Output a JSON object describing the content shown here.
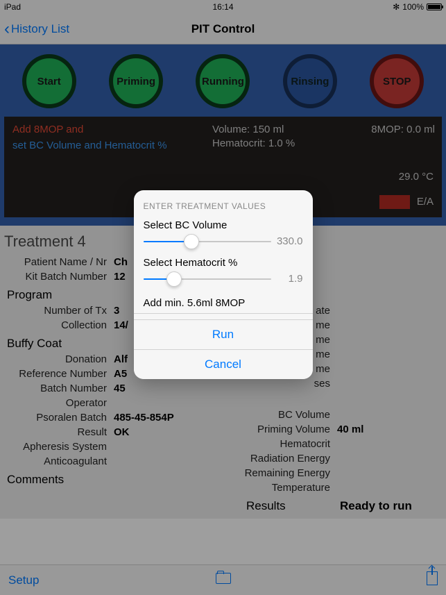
{
  "status_bar": {
    "device": "iPad",
    "time": "16:14",
    "bt": "✻",
    "battery": "100%"
  },
  "nav": {
    "back": "History List",
    "title": "PIT Control"
  },
  "buttons": {
    "start": "Start",
    "priming": "Priming",
    "running": "Running",
    "rinsing": "Rinsing",
    "stop": "STOP"
  },
  "info": {
    "line1": "Add 8MOP and",
    "line2": "set BC Volume and Hematocrit %",
    "vol": "Volume: 150 ml",
    "hct": "Hematocrit: 1.0 %",
    "mop": "8MOP: 0.0 ml",
    "temp": "29.0 °C",
    "ea": "E/A"
  },
  "treatment_title": "Treatment 4",
  "labels": {
    "patient": "Patient Name / Nr",
    "kit": "Kit Batch Number",
    "program": "Program",
    "ntx": "Number of Tx",
    "collection": "Collection",
    "buffy": "Buffy Coat",
    "donation": "Donation",
    "ref": "Reference Number",
    "batch": "Batch Number",
    "operator": "Operator",
    "psoralen": "Psoralen Batch",
    "result": "Result",
    "apheresis": "Apheresis System",
    "anticoag": "Anticoagulant",
    "comments": "Comments",
    "date": "ate",
    "starttime": "me",
    "runtime": "me",
    "primetime": "me",
    "rinsetime": "me",
    "pauses": "ses",
    "bcvol": "BC Volume",
    "primevol": "Priming Volume",
    "hematocrit": "Hematocrit",
    "radenergy": "Radiation Energy",
    "remenergy": "Remaining Energy",
    "temperature": "Temperature",
    "results": "Results"
  },
  "values": {
    "patient": "Ch",
    "kit": "12",
    "ntx": "3",
    "collection": "14/",
    "donation": "Alf",
    "ref": "A5",
    "batch": "45",
    "operator": "",
    "psoralen": "485-45-854P",
    "result": "OK",
    "apheresis": "",
    "anticoag": "",
    "primevol": "40 ml",
    "results": "Ready to run"
  },
  "dialog": {
    "header": "ENTER TREATMENT VALUES",
    "bc_label": "Select BC Volume",
    "bc_value": "330.0",
    "bc_pct": 38,
    "hct_label": "Select Hematocrit %",
    "hct_value": "1.9",
    "hct_pct": 24,
    "add_label": "Add min. 5.6ml 8MOP",
    "run": "Run",
    "cancel": "Cancel"
  },
  "chart_data": {
    "type": "table",
    "title": "Enter Treatment Values",
    "rows": [
      {
        "label": "BC Volume",
        "value": 330.0,
        "unit": "ml"
      },
      {
        "label": "Hematocrit",
        "value": 1.9,
        "unit": "%"
      },
      {
        "label": "8MOP minimum",
        "value": 5.6,
        "unit": "ml"
      }
    ]
  },
  "toolbar": {
    "setup": "Setup"
  }
}
